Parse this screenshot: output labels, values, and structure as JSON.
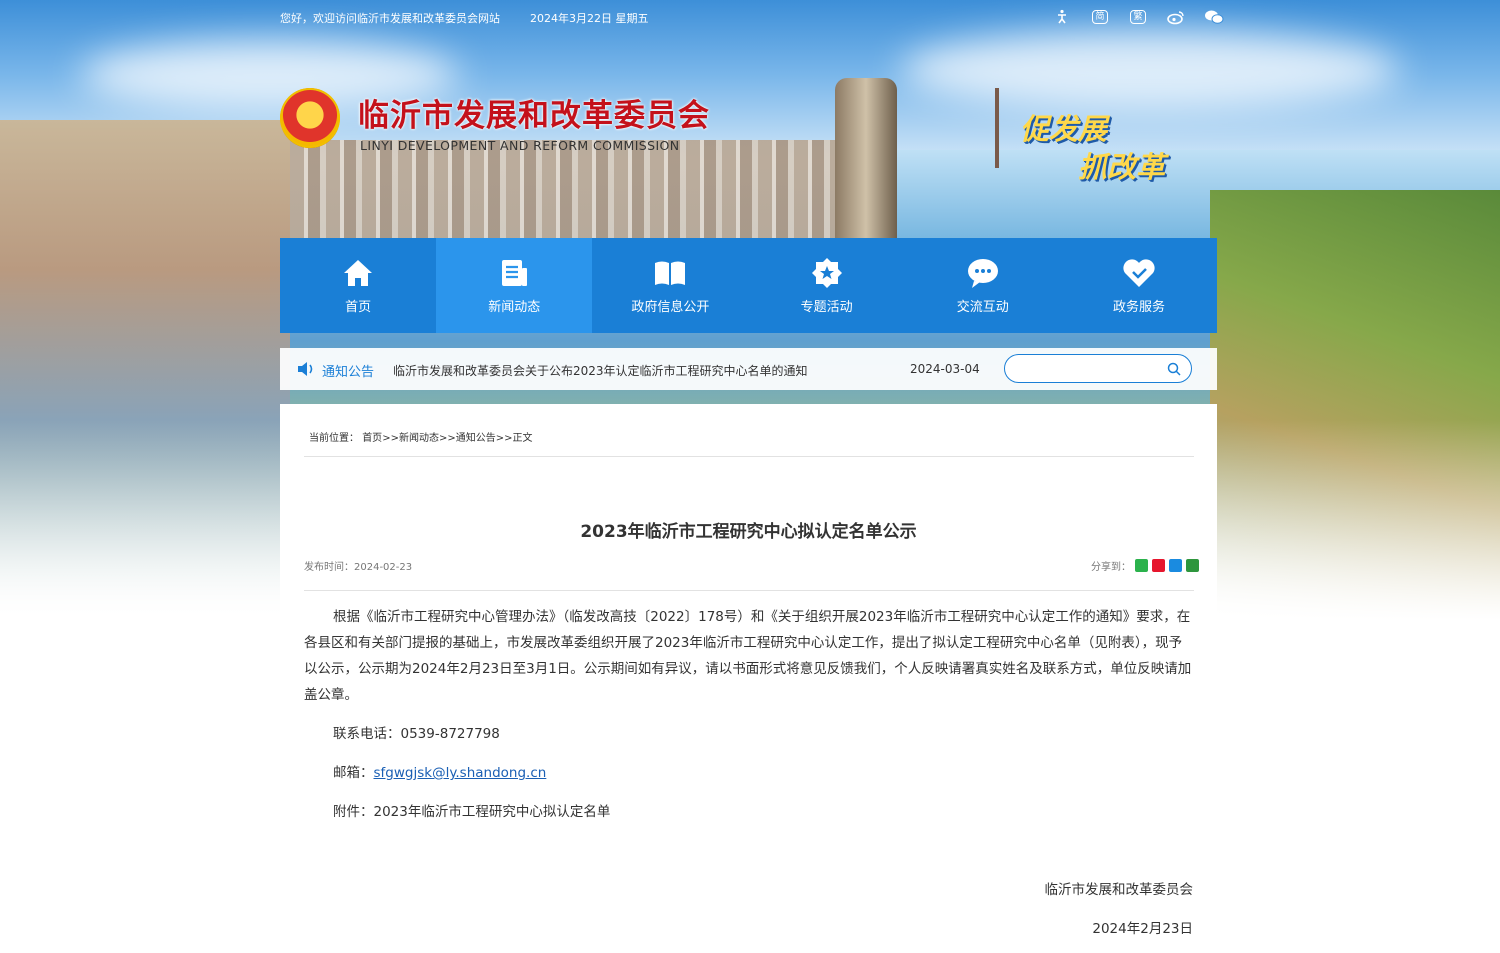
{
  "topbar": {
    "welcome": "您好，欢迎访问临沂市发展和改革委员会网站",
    "date": "2024年3月22日 星期五",
    "icons": [
      "accessibility-icon",
      "simplified-icon",
      "traditional-icon",
      "weibo-icon",
      "wechat-icon"
    ],
    "simplified": "简",
    "traditional": "繁"
  },
  "header": {
    "title_cn": "临沂市发展和改革委员会",
    "title_en": "LINYI DEVELOPMENT AND REFORM COMMISSION",
    "slogan_1": "促发展",
    "slogan_2": "抓改革"
  },
  "nav": {
    "items": [
      {
        "label": "首页",
        "icon": "home-icon"
      },
      {
        "label": "新闻动态",
        "icon": "news-icon"
      },
      {
        "label": "政府信息公开",
        "icon": "book-icon"
      },
      {
        "label": "专题活动",
        "icon": "star-badge-icon"
      },
      {
        "label": "交流互动",
        "icon": "chat-icon"
      },
      {
        "label": "政务服务",
        "icon": "heart-icon"
      }
    ],
    "active_index": 1
  },
  "notice": {
    "title": "通知公告",
    "text": "临沂市发展和改革委员会关于公布2023年认定临沂市工程研究中心名单的通知",
    "date": "2024-03-04"
  },
  "search": {
    "placeholder": ""
  },
  "breadcrumb": {
    "prefix": "当前位置：",
    "items": [
      "首页",
      "新闻动态",
      "通知公告",
      "正文"
    ],
    "sep": ">>"
  },
  "article": {
    "title": "2023年临沂市工程研究中心拟认定名单公示",
    "pub_date": "发布时间：2024-02-23",
    "share_label": "分享到：",
    "paragraph": "根据《临沂市工程研究中心管理办法》（临发改高技〔2022〕178号）和《关于组织开展2023年临沂市工程研究中心认定工作的通知》要求，在各县区和有关部门提报的基础上，市发展改革委组织开展了2023年临沂市工程研究中心认定工作，提出了拟认定工程研究中心名单（见附表），现予以公示，公示期为2024年2月23日至3月1日。公示期间如有异议，请以书面形式将意见反馈我们，个人反映请署真实姓名及联系方式，单位反映请加盖公章。",
    "phone": "联系电话：0539-8727798",
    "email_label": "邮箱：",
    "email": "sfgwgjsk@ly.shandong.cn",
    "attachment": "附件：2023年临沂市工程研究中心拟认定名单",
    "signature": "临沂市发展和改革委员会",
    "sign_date": "2024年2月23日"
  },
  "colors": {
    "brand_blue": "#1a7fd6",
    "active_blue": "#2b95ec",
    "title_red": "#c4111b",
    "slogan_yellow": "#ffd84a"
  }
}
